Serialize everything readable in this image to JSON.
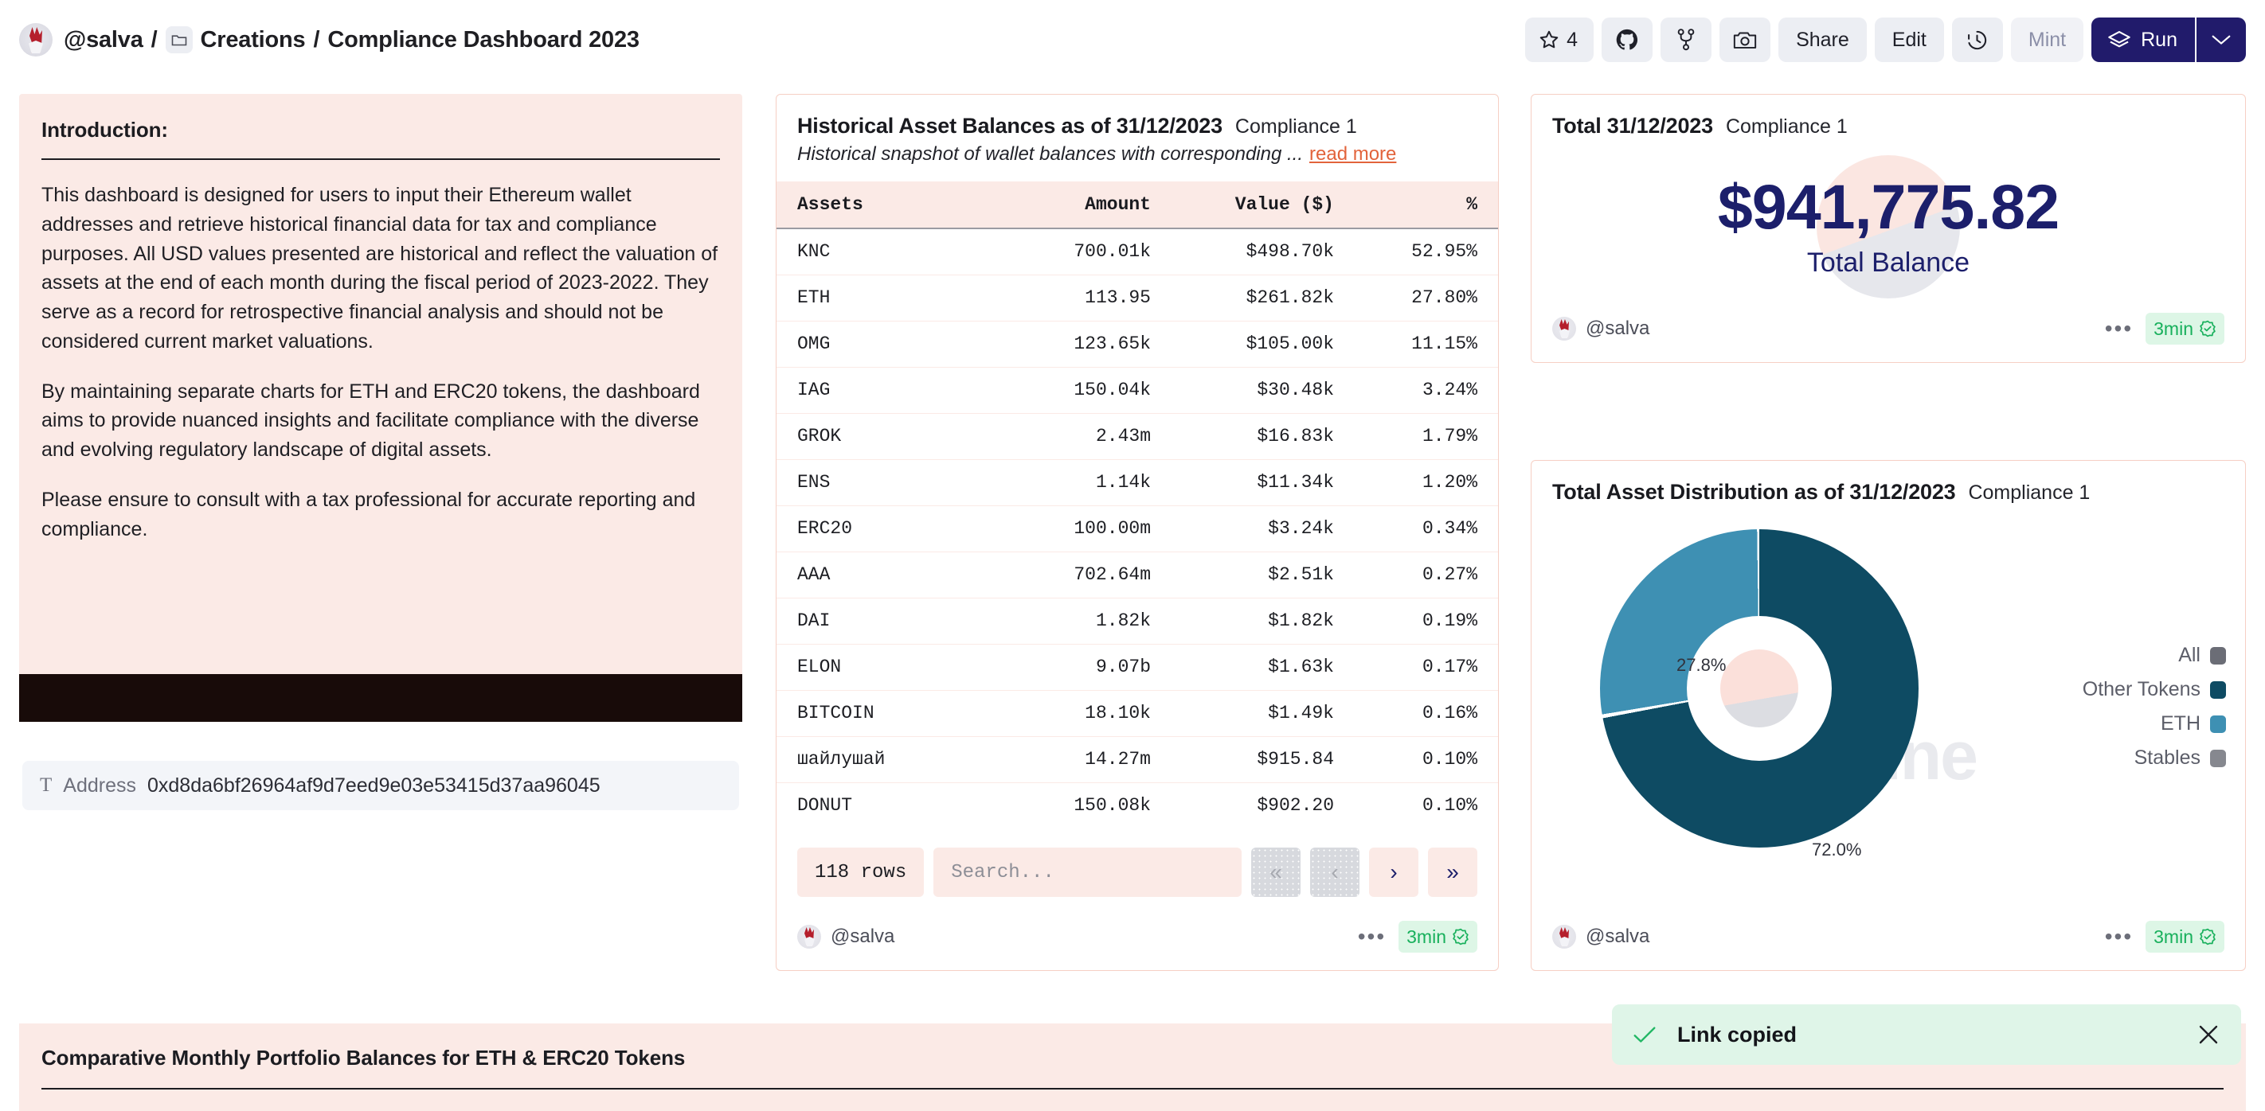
{
  "header": {
    "user": "@salva",
    "separator": "/",
    "folder": "Creations",
    "title": "Compliance Dashboard 2023",
    "folder_icon": "folder-icon",
    "actions": {
      "star_count": "4",
      "star_icon": "star-icon",
      "github_icon": "github-icon",
      "fork_icon": "fork-icon",
      "camera_icon": "camera-icon",
      "share": "Share",
      "edit": "Edit",
      "history_icon": "clock-history-icon",
      "mint": "Mint",
      "run": "Run",
      "run_icon": "layers-diamond-icon",
      "run_caret_icon": "chevron-down-icon"
    }
  },
  "intro": {
    "heading": "Introduction:",
    "paragraphs": [
      "This dashboard is designed for users to input their Ethereum wallet addresses and retrieve historical financial data for tax and compliance purposes. All USD values presented are historical and reflect the valuation of assets at the end of each month during the fiscal period of 2023-2022. They serve as a record for retrospective financial analysis and should not be considered current market valuations.",
      "By maintaining separate charts for ETH and ERC20 tokens, the dashboard aims to provide nuanced insights and facilitate compliance with the diverse and evolving regulatory landscape of digital assets.",
      "Please ensure to consult with a tax professional for accurate reporting and compliance."
    ]
  },
  "address_param": {
    "type_glyph": "T",
    "label": "Address",
    "value": "0xd8da6bf26964af9d7eed9e03e53415d37aa96045"
  },
  "table_panel": {
    "title": "Historical Asset Balances as of 31/12/2023",
    "subtitle": "Compliance 1",
    "description": "Historical snapshot of wallet balances with corresponding  ...",
    "read_more": "read more",
    "columns": [
      "Assets",
      "Amount",
      "Value ($)",
      "%"
    ],
    "rows": [
      {
        "asset": "KNC",
        "amount": "700.01k",
        "value": "$498.70k",
        "pct": "52.95%"
      },
      {
        "asset": "ETH",
        "amount": "113.95",
        "value": "$261.82k",
        "pct": "27.80%"
      },
      {
        "asset": "OMG",
        "amount": "123.65k",
        "value": "$105.00k",
        "pct": "11.15%"
      },
      {
        "asset": "IAG",
        "amount": "150.04k",
        "value": "$30.48k",
        "pct": "3.24%"
      },
      {
        "asset": "GROK",
        "amount": "2.43m",
        "value": "$16.83k",
        "pct": "1.79%"
      },
      {
        "asset": "ENS",
        "amount": "1.14k",
        "value": "$11.34k",
        "pct": "1.20%"
      },
      {
        "asset": "ERC20",
        "amount": "100.00m",
        "value": "$3.24k",
        "pct": "0.34%"
      },
      {
        "asset": "AAA",
        "amount": "702.64m",
        "value": "$2.51k",
        "pct": "0.27%"
      },
      {
        "asset": "DAI",
        "amount": "1.82k",
        "value": "$1.82k",
        "pct": "0.19%"
      },
      {
        "asset": "ELON",
        "amount": "9.07b",
        "value": "$1.63k",
        "pct": "0.17%"
      },
      {
        "asset": "BITCOIN",
        "amount": "18.10k",
        "value": "$1.49k",
        "pct": "0.16%"
      },
      {
        "asset": "шайлушай",
        "amount": "14.27m",
        "value": "$915.84",
        "pct": "0.10%"
      },
      {
        "asset": "DONUT",
        "amount": "150.08k",
        "value": "$902.20",
        "pct": "0.10%"
      }
    ],
    "row_count": "118 rows",
    "search_placeholder": "Search...",
    "pager": {
      "first": "«",
      "prev": "‹",
      "next": "›",
      "last": "»"
    },
    "byline_user": "@salva",
    "freshness": "3min"
  },
  "total_panel": {
    "title": "Total 31/12/2023",
    "subtitle": "Compliance 1",
    "value": "$941,775.82",
    "caption": "Total Balance",
    "byline_user": "@salva",
    "freshness": "3min"
  },
  "donut_panel": {
    "title": "Total Asset Distribution as of 31/12/2023",
    "subtitle": "Compliance 1",
    "watermark": "Dune",
    "byline_user": "@salva",
    "freshness": "3min",
    "chart_data": {
      "type": "pie",
      "title": "Total Asset Distribution as of 31/12/2023",
      "labels": [
        "Other Tokens",
        "ETH"
      ],
      "values": [
        72.0,
        27.8
      ],
      "data_labels": [
        "72.0%",
        "27.8%"
      ],
      "colors": [
        "#0e4b63",
        "#3e90b3"
      ],
      "legend_position": "right",
      "legend": [
        {
          "label": "All",
          "color": "#6b6d76"
        },
        {
          "label": "Other Tokens",
          "color": "#0e4b63"
        },
        {
          "label": "ETH",
          "color": "#3e90b3"
        },
        {
          "label": "Stables",
          "color": "#86888f"
        }
      ]
    }
  },
  "bottom_panel": {
    "heading": "Comparative Monthly Portfolio Balances for ETH & ERC20 Tokens"
  },
  "toast": {
    "check_icon": "check-icon",
    "message": "Link copied",
    "close_icon": "close-icon"
  },
  "colors": {
    "accent_pink": "#fbeae6",
    "brand_navy": "#1c1f6b",
    "link_orange": "#e2633b",
    "fresh_green": "#18b05c",
    "donut_dark": "#0e4b63",
    "donut_light": "#3e90b3"
  }
}
